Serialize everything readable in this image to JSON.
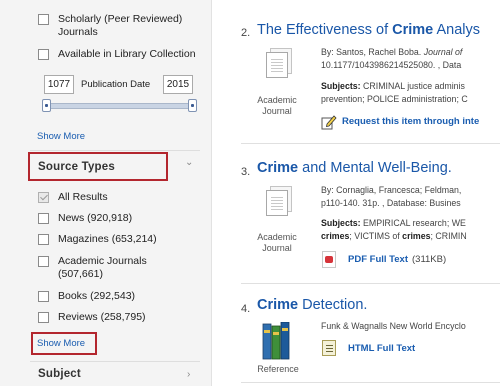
{
  "sidebar": {
    "limiters": {
      "scholarly_label": "Scholarly (Peer Reviewed) Journals",
      "library_label": "Available in Library Collection"
    },
    "date": {
      "from": "1077",
      "to": "2015",
      "label": "Publication Date"
    },
    "show_more_1": "Show More",
    "source_types": {
      "title": "Source Types",
      "items": [
        {
          "label": "All Results",
          "checked": true
        },
        {
          "label": "News (920,918)",
          "checked": false
        },
        {
          "label": "Magazines (653,214)",
          "checked": false
        },
        {
          "label": "Academic Journals (507,661)",
          "checked": false
        },
        {
          "label": "Books (292,543)",
          "checked": false
        },
        {
          "label": "Reviews (258,795)",
          "checked": false
        }
      ],
      "show_more": "Show More"
    },
    "subject": {
      "title": "Subject"
    }
  },
  "results": [
    {
      "number": "2.",
      "title_pre": "The Effectiveness of ",
      "title_kw": "Crime",
      "title_post": " Analys",
      "byline_1": "By: Santos, Rachel Boba. ",
      "byline_1_italic": "Journal of",
      "byline_2": "10.1177/1043986214525080. , Data",
      "subjects_label": "Subjects:",
      "subjects_1": " CRIMINAL justice adminis",
      "subjects_2": "prevention; POLICE administration; C",
      "type": "Academic Journal",
      "action": "Request this item through inte"
    },
    {
      "number": "3.",
      "title_kw": "Crime",
      "title_post": " and Mental Well-Being.",
      "byline_1": "By: Cornaglia, Francesca; Feldman, ",
      "byline_2": "p110-140. 31p. , Database: Busines",
      "subjects_label": "Subjects:",
      "subjects_1": " EMPIRICAL research; WE",
      "subjects_2_kw1": "crimes",
      "subjects_2_mid": "; VICTIMS of ",
      "subjects_2_kw2": "crimes",
      "subjects_2_post": "; CRIMIN",
      "type": "Academic Journal",
      "action": "PDF Full Text",
      "action_size": "(311KB)"
    },
    {
      "number": "4.",
      "title_kw": "Crime",
      "title_post": " Detection.",
      "byline_1": "Funk & Wagnalls New World Encyclo",
      "type": "Reference",
      "action": "HTML Full Text"
    }
  ],
  "colors": {
    "link": "#1a57a8",
    "highlight_box": "#b3262e",
    "sidebar_bg": "#f4f4f4"
  }
}
